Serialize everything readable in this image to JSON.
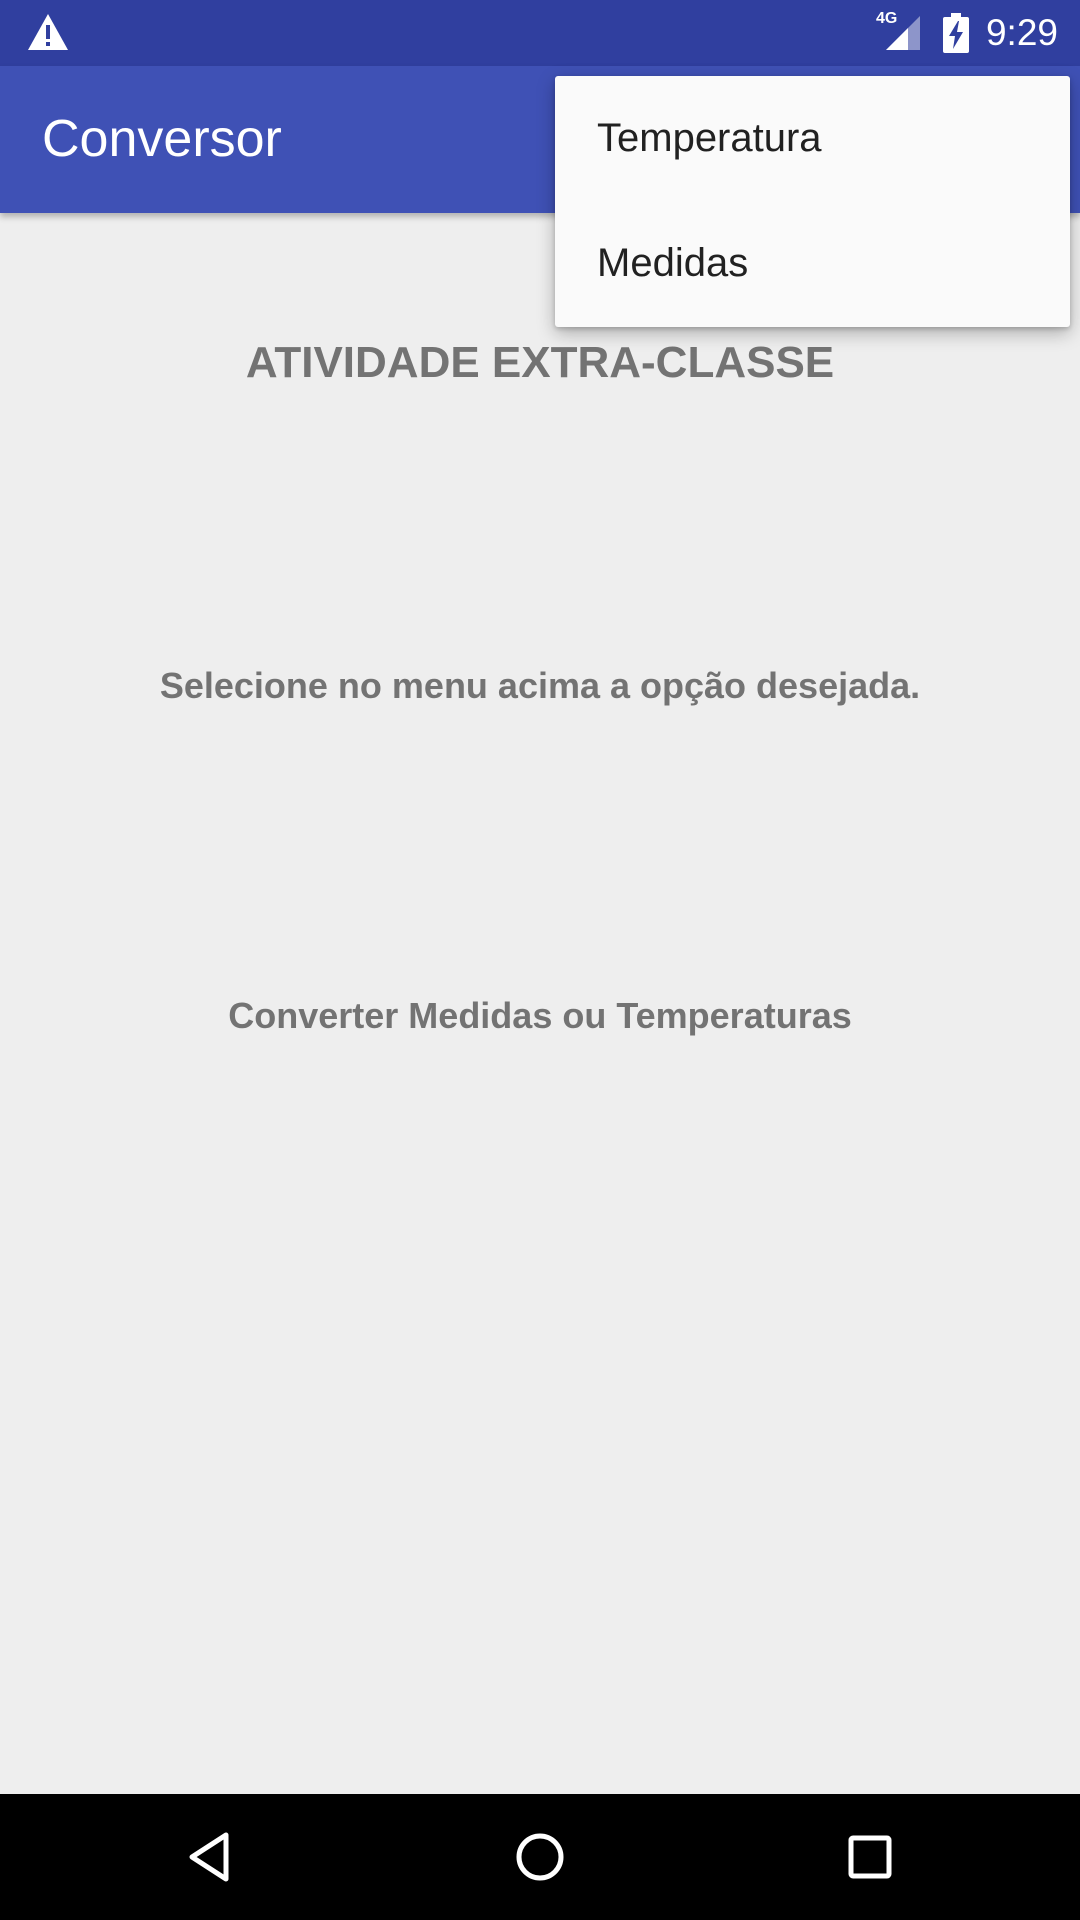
{
  "status_bar": {
    "warning_icon": "warning-triangle-icon",
    "network_label": "4G",
    "signal_icon": "cell-signal-icon",
    "battery_icon": "battery-charging-icon",
    "time": "9:29",
    "background_color": "#303f9f"
  },
  "app_bar": {
    "title": "Conversor",
    "background_color": "#3f51b5"
  },
  "overflow_menu": {
    "items": [
      {
        "label": "Temperatura"
      },
      {
        "label": "Medidas"
      }
    ]
  },
  "content": {
    "heading": "ATIVIDADE EXTRA-CLASSE",
    "instruction": "Selecione no menu acima a opção desejada.",
    "subtitle": "Converter Medidas ou Temperaturas",
    "text_color": "#737373",
    "background_color": "#eeeeee"
  },
  "nav_bar": {
    "back_icon": "back-triangle-icon",
    "home_icon": "home-circle-icon",
    "recents_icon": "recents-square-icon"
  }
}
